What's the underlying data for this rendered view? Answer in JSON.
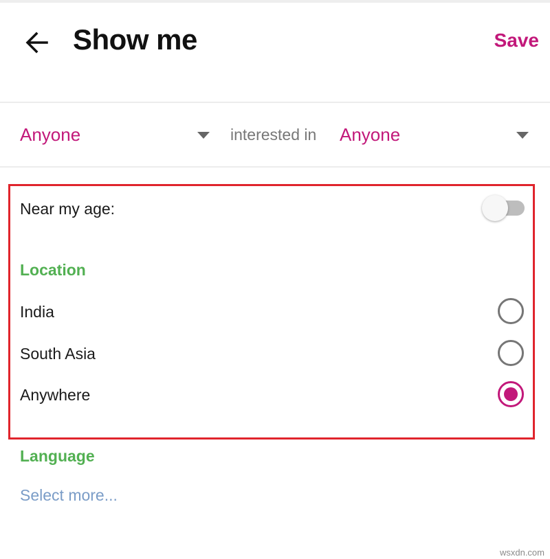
{
  "header": {
    "title": "Show me",
    "save_label": "Save"
  },
  "filters": {
    "left_value": "Anyone",
    "connector": "interested in",
    "right_value": "Anyone"
  },
  "age": {
    "label": "Near my age:",
    "enabled": false
  },
  "location": {
    "title": "Location",
    "options": [
      {
        "label": "India",
        "selected": false
      },
      {
        "label": "South Asia",
        "selected": false
      },
      {
        "label": "Anywhere",
        "selected": true
      }
    ]
  },
  "language": {
    "title": "Language",
    "link": "Select more..."
  },
  "colors": {
    "accent": "#c2187a",
    "section": "#52b052",
    "highlight": "#e0242c",
    "link": "#7a9cc7"
  },
  "icons": {
    "back": "arrow-left-icon",
    "dropdown": "caret-down-icon"
  },
  "watermark": "wsxdn.com"
}
